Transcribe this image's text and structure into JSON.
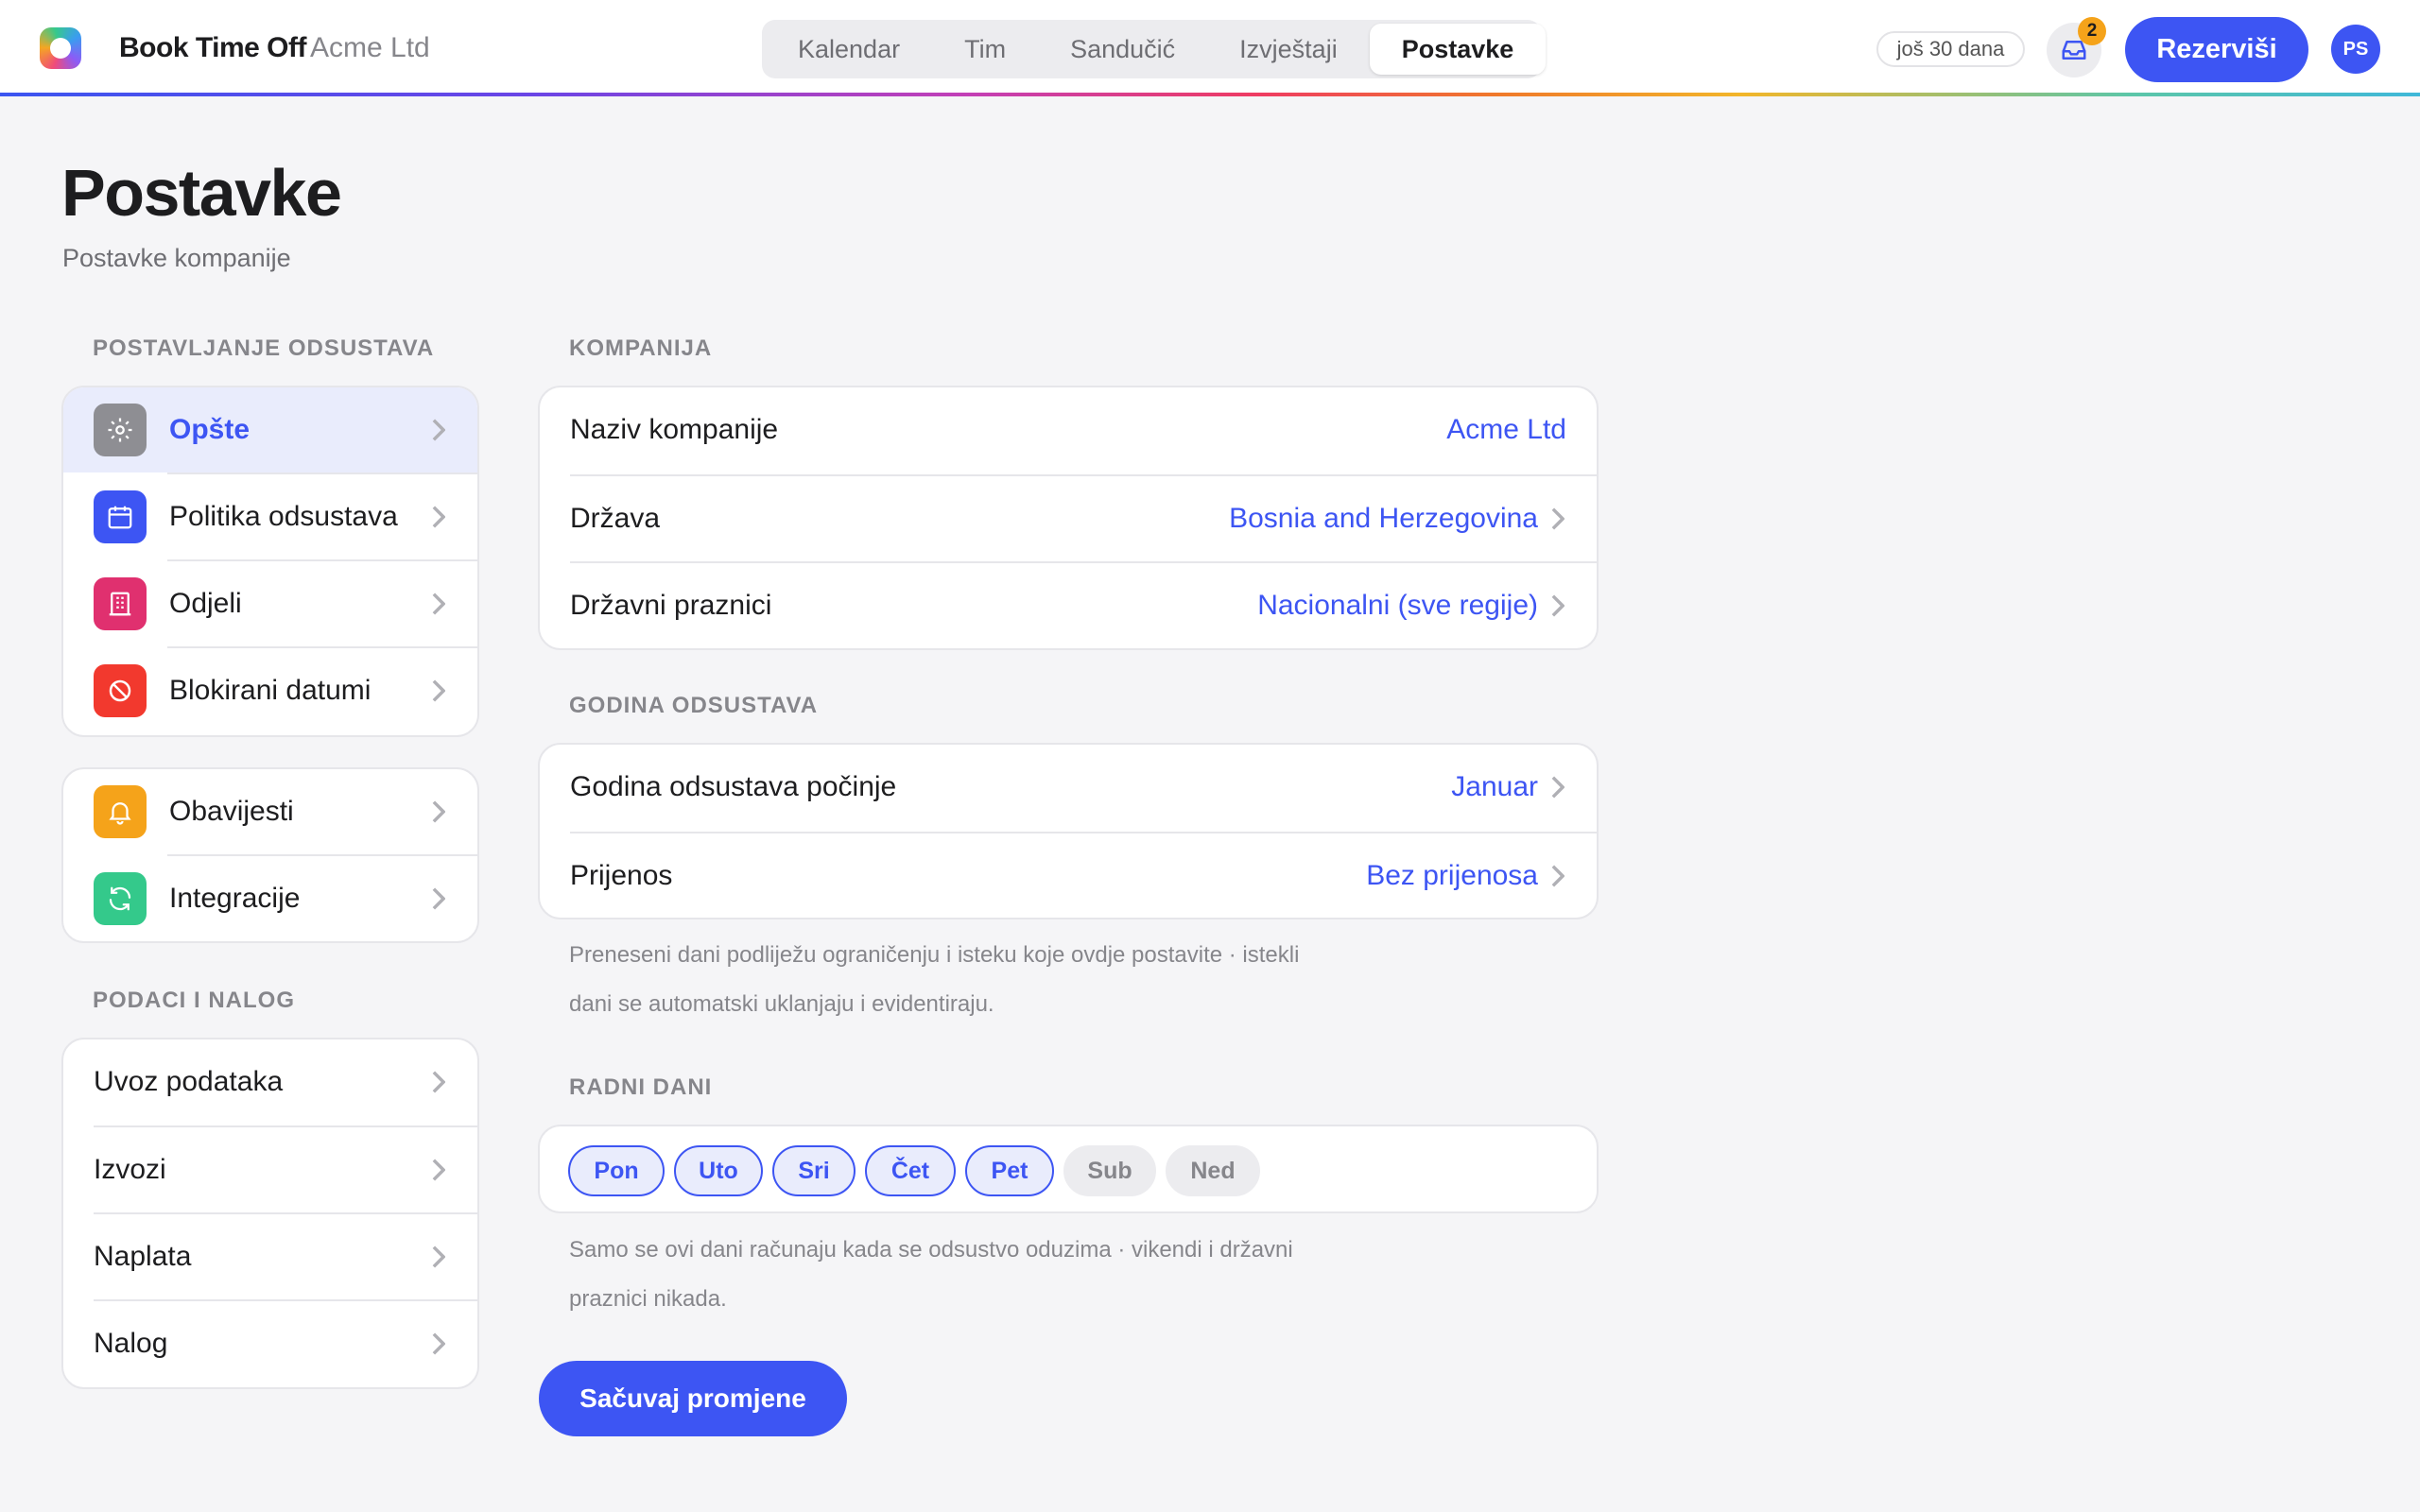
{
  "app": {
    "brand": "Book Time Off",
    "company": "Acme Ltd"
  },
  "nav": {
    "tabs": [
      "Kalendar",
      "Tim",
      "Sandučić",
      "Izvještaji",
      "Postavke"
    ],
    "active": "Postavke"
  },
  "header": {
    "trial": "još 30 dana",
    "inbox_count": "2",
    "book_label": "Rezerviši",
    "avatar_initials": "PS"
  },
  "page": {
    "title": "Postavke",
    "subtitle": "Postavke kompanije"
  },
  "sidebar": {
    "section1_label": "POSTAVLJANJE ODSUSTAVA",
    "group1": [
      {
        "label": "Opšte",
        "icon": "gear-icon",
        "color": "#8e8e93",
        "active": true
      },
      {
        "label": "Politika odsustava",
        "icon": "calendar-icon",
        "color": "#3d55f3",
        "active": false
      },
      {
        "label": "Odjeli",
        "icon": "building-icon",
        "color": "#e0306f",
        "active": false
      },
      {
        "label": "Blokirani datumi",
        "icon": "block-icon",
        "color": "#f2392e",
        "active": false
      }
    ],
    "group2": [
      {
        "label": "Obavijesti",
        "icon": "bell-icon",
        "color": "#f5a31a"
      },
      {
        "label": "Integracije",
        "icon": "sync-icon",
        "color": "#34c98b"
      }
    ],
    "section2_label": "PODACI I NALOG",
    "group3": [
      {
        "label": "Uvoz podataka"
      },
      {
        "label": "Izvozi"
      },
      {
        "label": "Naplata"
      },
      {
        "label": "Nalog"
      }
    ]
  },
  "company": {
    "section_label": "KOMPANIJA",
    "rows": [
      {
        "label": "Naziv kompanije",
        "value": "Acme Ltd"
      },
      {
        "label": "Država",
        "value": "Bosnia and Herzegovina"
      },
      {
        "label": "Državni praznici",
        "value": "Nacionalni (sve regije)"
      }
    ]
  },
  "leave_year": {
    "section_label": "GODINA ODSUSTAVA",
    "rows": [
      {
        "label": "Godina odsustava počinje",
        "value": "Januar"
      },
      {
        "label": "Prijenos",
        "value": "Bez prijenosa"
      }
    ],
    "note_line1": "Preneseni dani podliježu ograničenju i isteku koje ovdje postavite · istekli",
    "note_line2": "dani se automatski uklanjaju i evidentiraju."
  },
  "workdays": {
    "section_label": "RADNI DANI",
    "days": [
      {
        "label": "Pon",
        "on": true
      },
      {
        "label": "Uto",
        "on": true
      },
      {
        "label": "Sri",
        "on": true
      },
      {
        "label": "Čet",
        "on": true
      },
      {
        "label": "Pet",
        "on": true
      },
      {
        "label": "Sub",
        "on": false
      },
      {
        "label": "Ned",
        "on": false
      }
    ],
    "note_line1": "Samo se ovi dani računaju kada se odsustvo oduzima · vikendi i državni",
    "note_line2": "praznici nikada."
  },
  "actions": {
    "save_label": "Sačuvaj promjene"
  },
  "colors": {
    "accent": "#3d55f3",
    "active_bg": "#e9ecfc",
    "badge": "#f5a31a"
  }
}
